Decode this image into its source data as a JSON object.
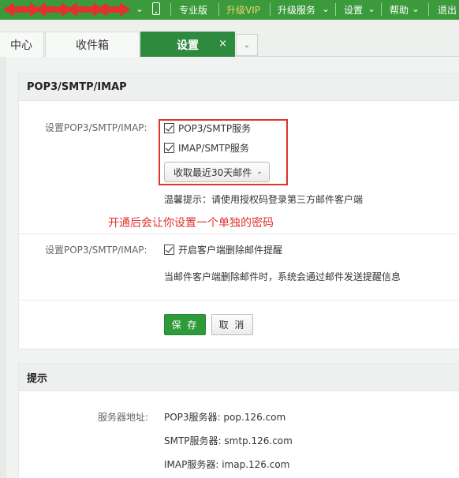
{
  "topbar": {
    "chevron": "⌄",
    "icons": {
      "redaction": "red-arrow-redaction",
      "phone": "phone-icon"
    },
    "items": [
      "专业版",
      "升级VIP",
      "升级服务",
      "设置",
      "帮助",
      "退出"
    ],
    "dropdown_chevron": "⌄"
  },
  "tabs": [
    "中心",
    "收件箱",
    "设置"
  ],
  "tab_close": "×",
  "tab_more": "⌄",
  "pop3_panel": {
    "title": "POP3/SMTP/IMAP",
    "setting_label": "设置POP3/SMTP/IMAP:",
    "option_pop3": "POP3/SMTP服务",
    "option_imap": "IMAP/SMTP服务",
    "fetch_select": "收取最近30天邮件",
    "select_arrow": "⌄",
    "hint": "温馨提示：请使用授权码登录第三方邮件客户端",
    "annotation": "开通后会让你设置一个单独的密码",
    "setting_label2": "设置POP3/SMTP/IMAP:",
    "option_delete_alert": "开启客户端删除邮件提醒",
    "delete_alert_desc": "当邮件客户端删除邮件时，系统会通过邮件发送提醒信息",
    "save": "保 存",
    "cancel": "取 消"
  },
  "tips_panel": {
    "title": "提示",
    "server_label": "服务器地址:",
    "pop3_server": "POP3服务器: pop.126.com",
    "smtp_server": "SMTP服务器: smtp.126.com",
    "imap_server": "IMAP服务器: imap.126.com"
  },
  "colors": {
    "brand_green": "#3b9a3b",
    "active_tab": "#2d8a3e",
    "annotation_red": "#e0322f",
    "vip_gold": "#f3d36e"
  }
}
